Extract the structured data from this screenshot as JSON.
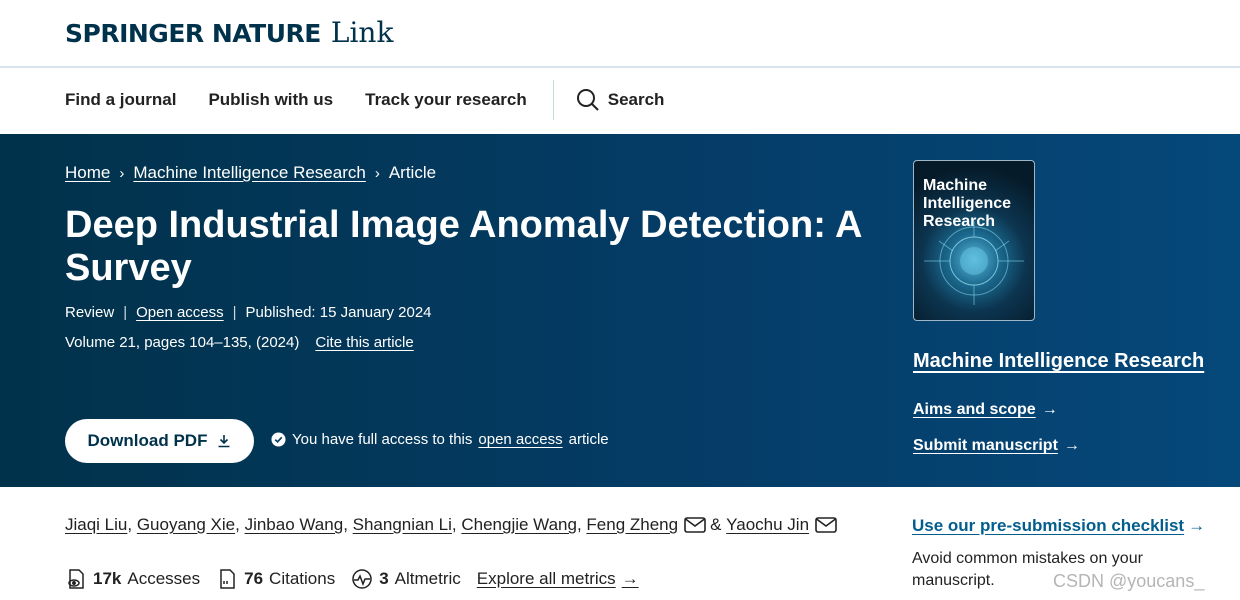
{
  "header": {
    "brand": "SPRINGER NATURE",
    "product": "Link"
  },
  "nav": {
    "items": [
      "Find a journal",
      "Publish with us",
      "Track your research"
    ],
    "search_label": "Search"
  },
  "breadcrumb": {
    "home": "Home",
    "journal": "Machine Intelligence Research",
    "current": "Article"
  },
  "article": {
    "title": "Deep Industrial Image Anomaly Detection: A Survey",
    "type": "Review",
    "open_access": "Open access",
    "published": "Published: 15 January 2024",
    "volume": "Volume 21, pages 104–135, (2024)",
    "cite": "Cite this article"
  },
  "download": {
    "label": "Download PDF"
  },
  "access": {
    "prefix": "You have full access to this",
    "link": "open access",
    "suffix": "article"
  },
  "journal": {
    "cover_title": "Machine Intelligence Research",
    "name": "Machine Intelligence Research",
    "aims": "Aims and scope",
    "submit": "Submit manuscript"
  },
  "authors": [
    "Jiaqi Liu",
    "Guoyang Xie",
    "Jinbao Wang",
    "Shangnian Li",
    "Chengjie Wang",
    "Feng Zheng",
    "Yaochu Jin"
  ],
  "metrics": {
    "accesses_value": "17k",
    "accesses_label": "Accesses",
    "citations_value": "76",
    "citations_label": "Citations",
    "altmetric_value": "3",
    "altmetric_label": "Altmetric",
    "explore": "Explore all metrics"
  },
  "checklist": {
    "link": "Use our pre-submission checklist",
    "desc": "Avoid common mistakes on your manuscript."
  },
  "watermark": "CSDN @youcans_",
  "colors": {
    "hero_bg": "#01324b",
    "link_blue": "#025e8d",
    "brand": "#01324b"
  }
}
